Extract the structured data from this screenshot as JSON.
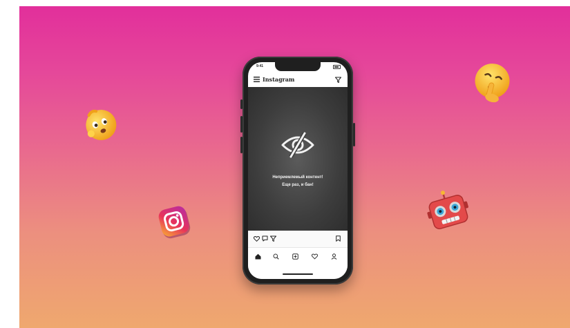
{
  "app": {
    "title": "Instagram"
  },
  "status_bar": {
    "time": "9:41"
  },
  "content": {
    "warning_line1": "Неприемлемый контент!",
    "warning_line2": "Еще раз, и бан!"
  },
  "icons": {
    "menu": "menu-icon",
    "filter": "filter-icon",
    "eye_off": "eye-slash-icon",
    "like": "heart-icon",
    "comment": "comment-icon",
    "share": "send-icon",
    "save": "bookmark-icon",
    "home": "home-icon",
    "search": "search-icon",
    "add": "add-post-icon",
    "activity": "heart-icon",
    "profile": "profile-icon"
  },
  "colors": {
    "gradient_top": "#e22f9b",
    "gradient_bottom": "#efa86e",
    "phone_body": "#1f1f1f",
    "content_bg": "#3d3d3d"
  }
}
